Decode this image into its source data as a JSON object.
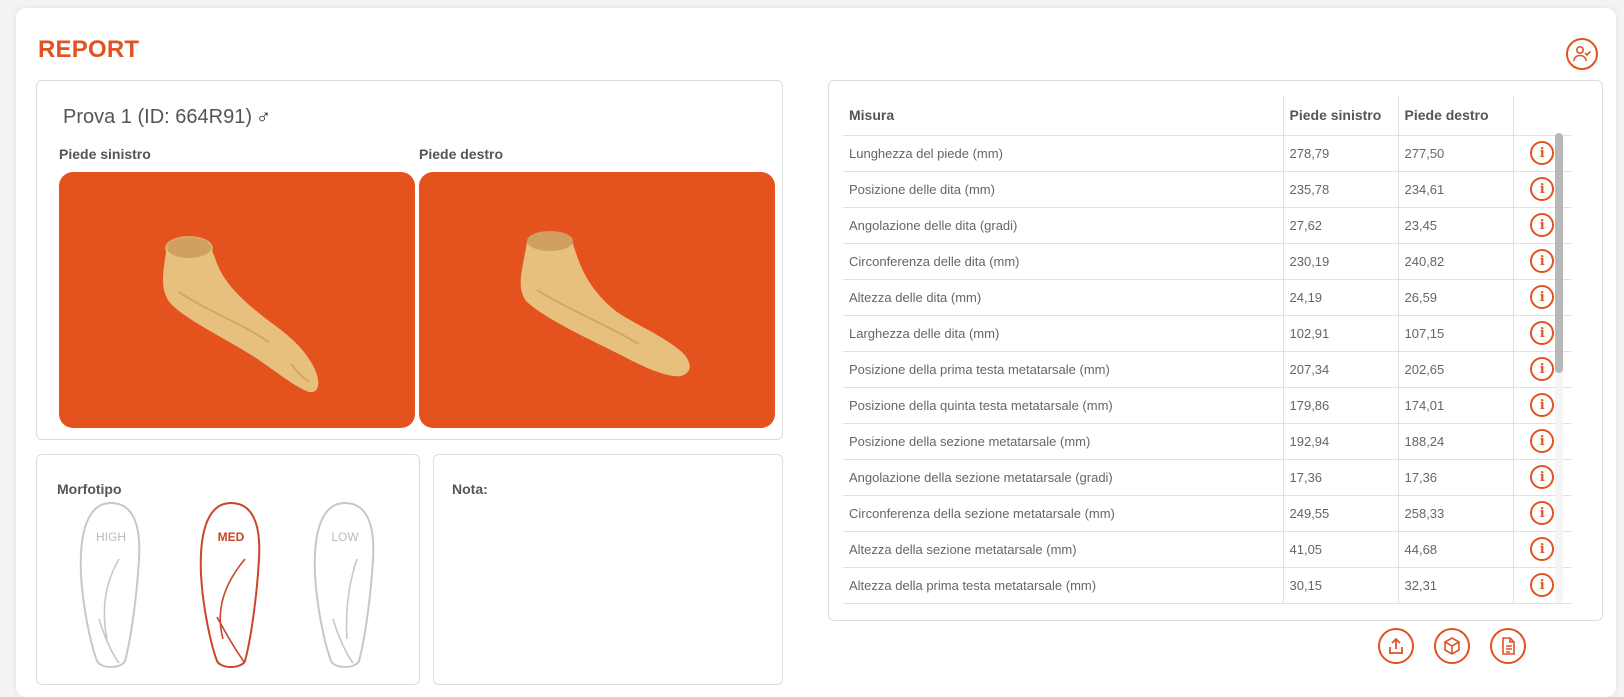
{
  "header": {
    "title": "REPORT",
    "user_icon": "user-check-icon"
  },
  "test": {
    "label": "Prova 1 (ID: 664R91)",
    "gender_symbol": "♂"
  },
  "feet": {
    "left_label": "Piede sinistro",
    "right_label": "Piede destro"
  },
  "morphotype": {
    "label": "Morfotipo",
    "options": [
      "HIGH",
      "MED",
      "LOW"
    ],
    "selected": "MED"
  },
  "note": {
    "label": "Nota:",
    "value": ""
  },
  "table": {
    "headers": [
      "Misura",
      "Piede sinistro",
      "Piede destro",
      ""
    ],
    "rows": [
      [
        "Lunghezza del piede (mm)",
        "278,79",
        "277,50"
      ],
      [
        "Posizione delle dita (mm)",
        "235,78",
        "234,61"
      ],
      [
        "Angolazione delle dita (gradi)",
        "27,62",
        "23,45"
      ],
      [
        "Circonferenza delle dita (mm)",
        "230,19",
        "240,82"
      ],
      [
        "Altezza delle dita (mm)",
        "24,19",
        "26,59"
      ],
      [
        "Larghezza delle dita (mm)",
        "102,91",
        "107,15"
      ],
      [
        "Posizione della prima testa metatarsale (mm)",
        "207,34",
        "202,65"
      ],
      [
        "Posizione della quinta testa metatarsale (mm)",
        "179,86",
        "174,01"
      ],
      [
        "Posizione della sezione metatarsale (mm)",
        "192,94",
        "188,24"
      ],
      [
        "Angolazione della sezione metatarsale (gradi)",
        "17,36",
        "17,36"
      ],
      [
        "Circonferenza della sezione metatarsale (mm)",
        "249,55",
        "258,33"
      ],
      [
        "Altezza della sezione metatarsale (mm)",
        "41,05",
        "44,68"
      ],
      [
        "Altezza della prima testa metatarsale (mm)",
        "30,15",
        "32,31"
      ]
    ],
    "info_icon": "info-icon"
  },
  "actions": [
    "export-icon",
    "3d-model-icon",
    "document-icon"
  ],
  "colors": {
    "accent": "#e05322",
    "foot_bg": "#e4521d",
    "foot_skin": "#e8c07e"
  }
}
